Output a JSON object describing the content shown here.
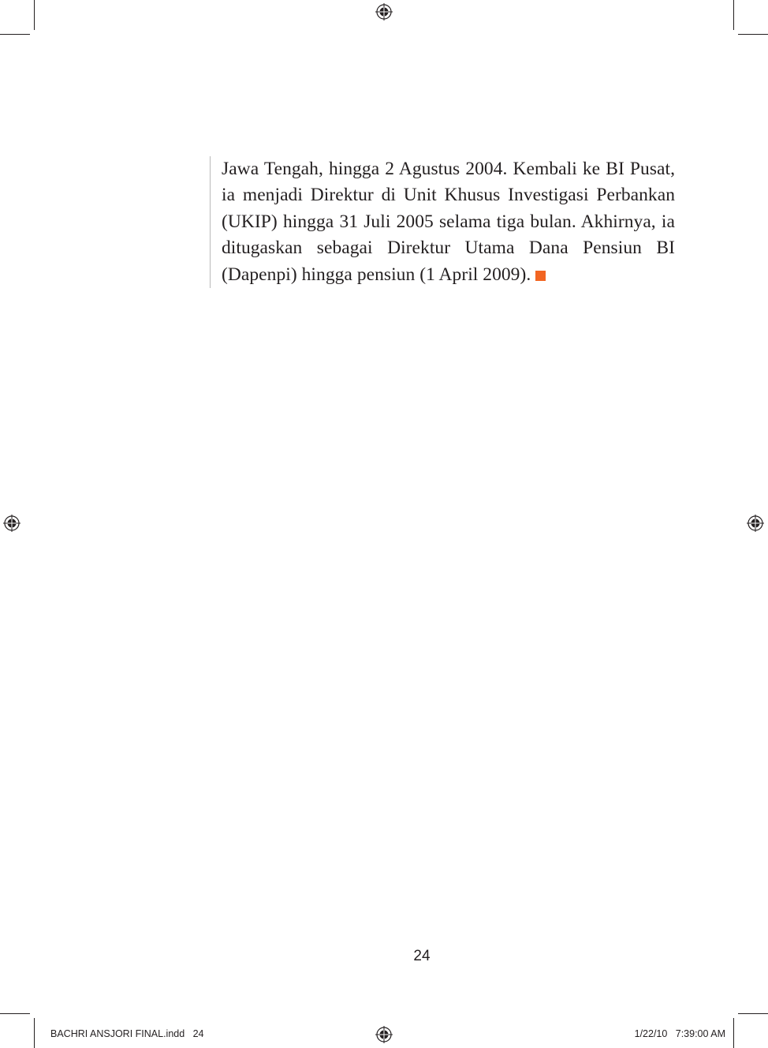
{
  "body": {
    "paragraph": "Jawa Tengah, hingga 2 Agustus 2004. Kembali ke BI Pusat, ia menjadi Direktur di Unit Khusus Investigasi Perbankan (UKIP) hingga 31 Juli 2005 selama tiga bulan. Akhirnya, ia ditugaskan sebagai Direktur Utama Dana Pensiun BI (Dapenpi) hingga pensiun (1 April 2009).",
    "end_mark_color": "#f26522"
  },
  "footer": {
    "page_number": "24"
  },
  "slug": {
    "file_info": "BACHRI ANSJORI FINAL.indd   24",
    "date_time": "1/22/10   7:39:00 AM"
  },
  "icons": {
    "registration_mark": "registration-target-icon",
    "end_mark": "orange-square-icon"
  }
}
